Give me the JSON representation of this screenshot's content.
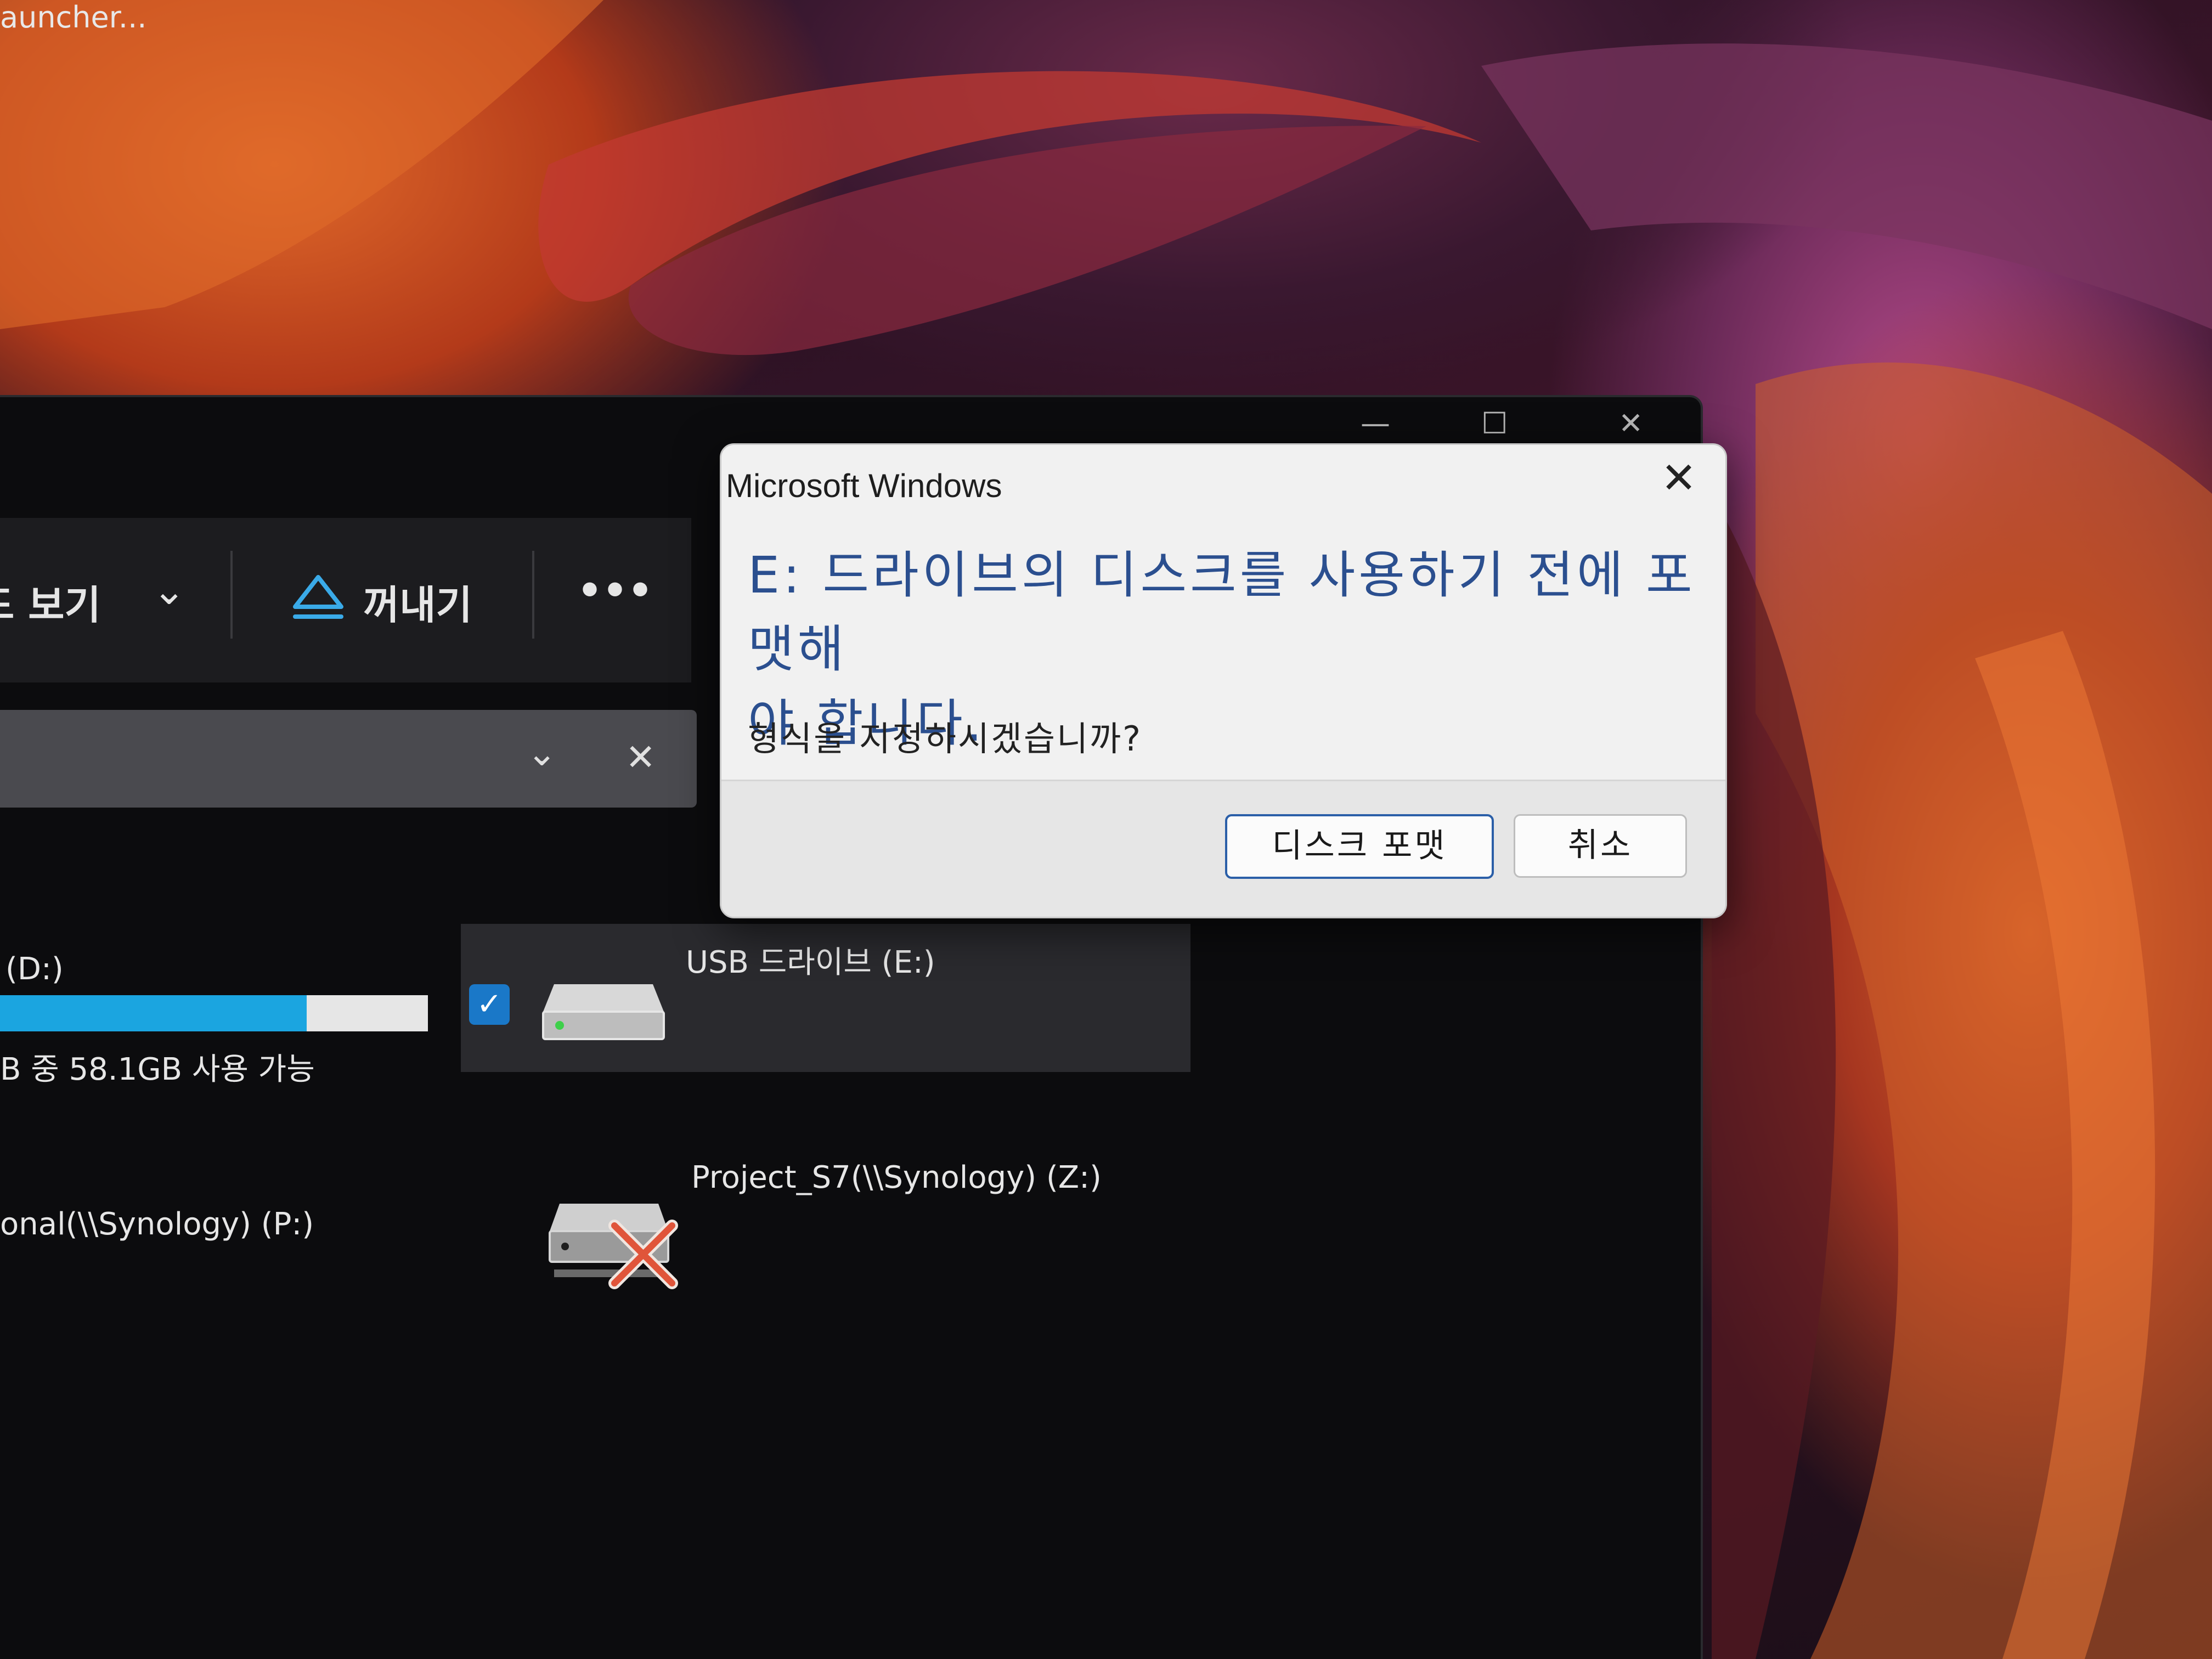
{
  "desktop": {
    "top_label": "auncher..."
  },
  "explorer": {
    "window_controls": {
      "minimize_glyph": "—",
      "maximize_glyph": "☐",
      "close_glyph": "✕"
    },
    "toolbar": {
      "view_label": "드 보기",
      "view_chevron": "⌄",
      "eject_label": "꺼내기",
      "more_glyph": "•••"
    },
    "address_bar": {
      "dropdown_glyph": "⌄",
      "clear_glyph": "✕"
    },
    "drives": {
      "d": {
        "label": "(D:)",
        "usage_text": "B 중 58.1GB 사용 가능",
        "used_fraction": 0.73,
        "bar_color": "#1ba5e0"
      },
      "e": {
        "label": "USB 드라이브 (E:)",
        "check_glyph": "✓",
        "selected": true
      },
      "p": {
        "label": "onal(\\\\Synology) (P:)"
      },
      "z": {
        "label": "Project_S7(\\\\Synology) (Z:)",
        "disconnected": true
      }
    }
  },
  "dialog": {
    "title": "Microsoft Windows",
    "close_glyph": "✕",
    "message_line1": "E: 드라이브의 디스크를 사용하기 전에 포맷해",
    "message_line2": "야 합니다.",
    "question": "형식을 지정하시겠습니까?",
    "format_button": "디스크 포맷",
    "cancel_button": "취소",
    "accent_color": "#2b4f8f"
  }
}
